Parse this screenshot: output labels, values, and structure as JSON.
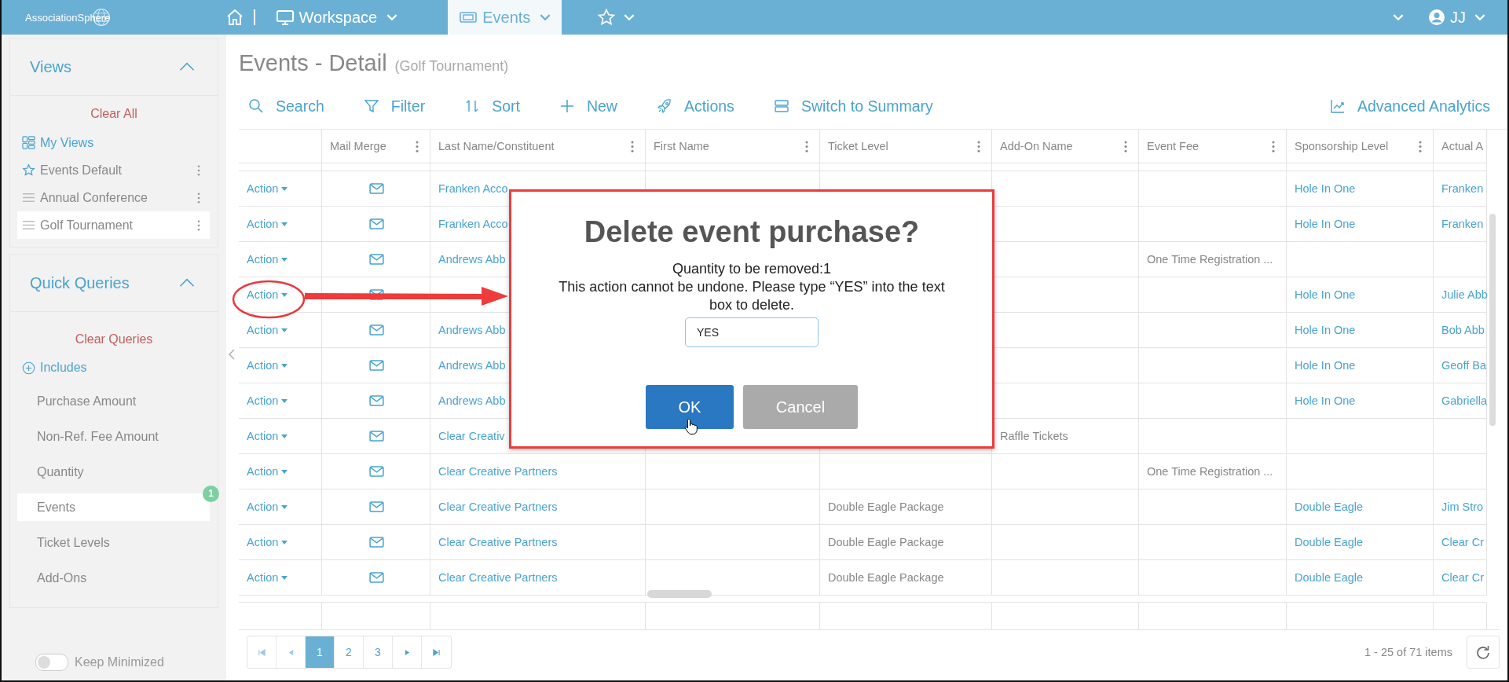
{
  "top_bar": {
    "logo": "AssociationSphere",
    "menus": [
      {
        "label": "Workspace",
        "selected": false
      },
      {
        "label": "Events",
        "selected": true
      }
    ],
    "user": "JJ"
  },
  "sidebar": {
    "views": {
      "title": "Views",
      "expanded": true,
      "clear": "Clear All",
      "items": [
        {
          "label": "My Views",
          "kind": "link",
          "selected": false
        },
        {
          "label": "Events Default",
          "kind": "default",
          "selected": false
        },
        {
          "label": "Annual Conference",
          "kind": "view",
          "selected": false
        },
        {
          "label": "Golf Tournament",
          "kind": "view",
          "selected": true
        }
      ]
    },
    "queries": {
      "title": "Quick Queries",
      "expanded": true,
      "clear": "Clear Queries",
      "includes": "Includes",
      "items": [
        {
          "label": "Purchase Amount",
          "selected": false
        },
        {
          "label": "Non-Ref. Fee Amount",
          "selected": false
        },
        {
          "label": "Quantity",
          "selected": false
        },
        {
          "label": "Events",
          "selected": true,
          "badge": "1"
        },
        {
          "label": "Ticket Levels",
          "selected": false
        },
        {
          "label": "Add-Ons",
          "selected": false
        }
      ]
    },
    "keep_minimized": {
      "label": "Keep Minimized",
      "on": false
    }
  },
  "page": {
    "title": "Events - Detail",
    "subtitle": "(Golf Tournament)"
  },
  "toolbar": {
    "actions": [
      "Search",
      "Filter",
      "Sort",
      "New",
      "Actions",
      "Switch to Summary"
    ],
    "analytics": "Advanced Analytics"
  },
  "table": {
    "columns": [
      "Mail Merge",
      "Last Name/Constituent",
      "First Name",
      "Ticket Level",
      "Add-On Name",
      "Event Fee",
      "Sponsorship Level",
      "Actual A"
    ],
    "rows": [
      {
        "action": "Action",
        "last_name": "Franken Acco",
        "sponsorship": "Hole In One",
        "column_9": "Franken"
      },
      {
        "action": "Action",
        "last_name": "Franken Acco",
        "sponsorship": "Hole In One",
        "column_9": "Franken"
      },
      {
        "action": "Action",
        "last_name": "Andrews Abb",
        "event_fee": "One Time Registration ..."
      },
      {
        "action": "Action",
        "sponsorship": "Hole In One",
        "column_9": "Julie Abb"
      },
      {
        "action": "Action",
        "last_name": "Andrews Abb",
        "sponsorship": "Hole In One",
        "column_9": "Bob Abb"
      },
      {
        "action": "Action",
        "last_name": "Andrews Abb",
        "sponsorship": "Hole In One",
        "column_9": "Geoff Ba"
      },
      {
        "action": "Action",
        "last_name": "Andrews Abb",
        "sponsorship": "Hole In One",
        "column_9": "Gabriella"
      },
      {
        "action": "Action",
        "last_name": "Clear Creativ",
        "add_on": "Raffle Tickets"
      },
      {
        "action": "Action",
        "last_name": "Clear Creative Partners",
        "event_fee": "One Time Registration ..."
      },
      {
        "action": "Action",
        "last_name": "Clear Creative Partners",
        "ticket_level": "Double Eagle Package",
        "sponsorship": "Double Eagle",
        "column_9": "Jim Stro"
      },
      {
        "action": "Action",
        "last_name": "Clear Creative Partners",
        "ticket_level": "Double Eagle Package",
        "sponsorship": "Double Eagle",
        "column_9": "Clear Cr"
      },
      {
        "action": "Action",
        "last_name": "Clear Creative Partners",
        "ticket_level": "Double Eagle Package",
        "sponsorship": "Double Eagle",
        "column_9": "Clear Cr"
      }
    ]
  },
  "pager": {
    "pages": [
      {
        "label": "1",
        "selected": true
      },
      {
        "label": "2",
        "selected": false
      },
      {
        "label": "3",
        "selected": false
      }
    ],
    "summary": "1 - 25 of 71 items"
  },
  "dialog": {
    "title": "Delete event purchase?",
    "lines": [
      "Quantity to be removed:1",
      "This action cannot be undone. Please type “YES” into the text box to delete."
    ],
    "value": "YES",
    "buttons": [
      {
        "label": "OK",
        "kind": "primary"
      },
      {
        "label": "Cancel",
        "kind": "secondary"
      }
    ]
  }
}
